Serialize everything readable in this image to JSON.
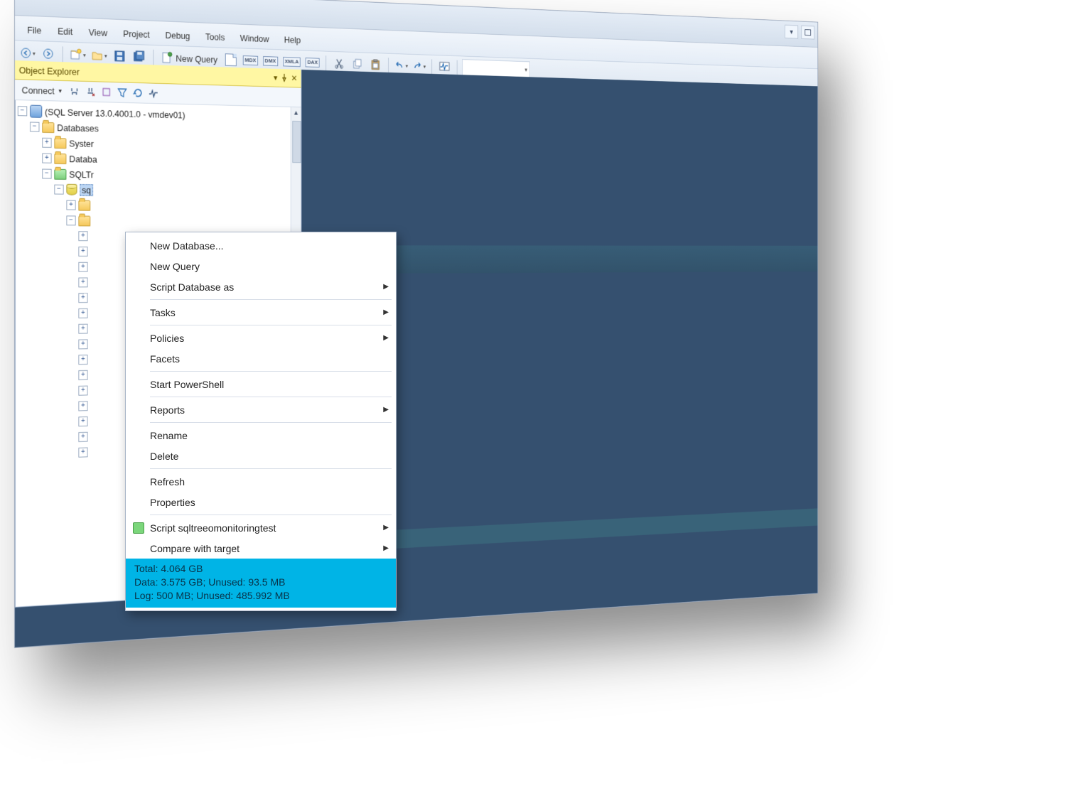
{
  "menubar": {
    "items": [
      "File",
      "Edit",
      "View",
      "Project",
      "Debug",
      "Tools",
      "Window",
      "Help"
    ]
  },
  "toolbar": {
    "nav_back_icon": "nav-back-icon",
    "nav_fwd_icon": "nav-forward-icon",
    "newquery_label": "New Query",
    "script_icons": [
      "MDX",
      "DMX",
      "XMLA",
      "DAX"
    ]
  },
  "explorer": {
    "title": "Object Explorer",
    "connect_label": "Connect",
    "server_label": "(SQL Server 13.0.4001.0 - vmdev01)",
    "nodes": {
      "databases": "Databases",
      "system": "Syster",
      "dbsnap": "Databa",
      "sqltr": "SQLTr",
      "selected": "sq"
    }
  },
  "context_menu": {
    "items": [
      {
        "label": "New Database...",
        "submenu": false
      },
      {
        "label": "New Query",
        "submenu": false
      },
      {
        "label": "Script Database as",
        "submenu": true
      },
      {
        "sep": true
      },
      {
        "label": "Tasks",
        "submenu": true
      },
      {
        "sep": true
      },
      {
        "label": "Policies",
        "submenu": true
      },
      {
        "label": "Facets",
        "submenu": false
      },
      {
        "sep": true
      },
      {
        "label": "Start PowerShell",
        "submenu": false
      },
      {
        "sep": true
      },
      {
        "label": "Reports",
        "submenu": true
      },
      {
        "sep": true
      },
      {
        "label": "Rename",
        "submenu": false
      },
      {
        "label": "Delete",
        "submenu": false
      },
      {
        "sep": true
      },
      {
        "label": "Refresh",
        "submenu": false
      },
      {
        "label": "Properties",
        "submenu": false
      },
      {
        "sep": true
      },
      {
        "label": "Script sqltreeomonitoringtest",
        "submenu": true,
        "icon": "green"
      },
      {
        "label": "Compare with target",
        "submenu": true
      }
    ],
    "stats": {
      "line1": "Total: 4.064 GB",
      "line2": "Data: 3.575 GB; Unused: 93.5 MB",
      "line3": "Log: 500 MB; Unused: 485.992 MB"
    }
  }
}
